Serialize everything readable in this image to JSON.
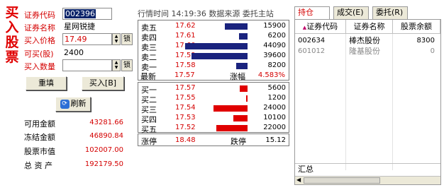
{
  "title": {
    "chars": [
      "买",
      "入",
      "股",
      "票"
    ]
  },
  "form": {
    "code_label": "证券代码",
    "code_value": "002396",
    "name_label": "证券名称",
    "name_value": "星网锐捷",
    "price_label": "买入价格",
    "price_value": "17.49",
    "avail_label": "可买(股)",
    "avail_value": "2400",
    "qty_label": "买入数量",
    "qty_value": "",
    "lock_label": "锁",
    "reset_button": "重填",
    "buy_button": "买入[B]",
    "refresh_button": "刷新"
  },
  "account": [
    {
      "label": "可用金额",
      "value": "43281.66"
    },
    {
      "label": "冻结金额",
      "value": "46890.84"
    },
    {
      "label": "股票市值",
      "value": "102007.00"
    },
    {
      "label": "总 资 产",
      "value": "192179.50"
    }
  ],
  "quote": {
    "header": "行情时间 14:19:36 数据来源 委托主站",
    "sell": [
      {
        "name": "卖五",
        "price": "17.62",
        "vol": "15900",
        "vol_num": 15900
      },
      {
        "name": "卖四",
        "price": "17.61",
        "vol": "6200",
        "vol_num": 6200
      },
      {
        "name": "卖三",
        "price": "17.60",
        "vol": "44090",
        "vol_num": 44090
      },
      {
        "name": "卖二",
        "price": "17.59",
        "vol": "39600",
        "vol_num": 39600
      },
      {
        "name": "卖一",
        "price": "17.58",
        "vol": "8200",
        "vol_num": 8200
      }
    ],
    "latest_label": "最新",
    "latest_value": "17.57",
    "change_label": "涨幅",
    "change_value": "4.583%",
    "buy": [
      {
        "name": "买一",
        "price": "17.57",
        "vol": "5600",
        "vol_num": 5600
      },
      {
        "name": "买二",
        "price": "17.55",
        "vol": "1200",
        "vol_num": 1200
      },
      {
        "name": "买三",
        "price": "17.54",
        "vol": "24000",
        "vol_num": 24000
      },
      {
        "name": "买四",
        "price": "17.53",
        "vol": "10100",
        "vol_num": 10100
      },
      {
        "name": "买五",
        "price": "17.52",
        "vol": "22000",
        "vol_num": 22000
      }
    ],
    "limit_up_label": "涨停",
    "limit_up_value": "18.48",
    "limit_down_label": "跌停",
    "limit_down_value": "15.12",
    "colors": {
      "sell_bar": "#1a237e",
      "buy_bar": "#e00000"
    }
  },
  "tabs": [
    {
      "label": "持仓(W)",
      "active": true
    },
    {
      "label": "成交(E)",
      "active": false
    },
    {
      "label": "委托(R)",
      "active": false
    }
  ],
  "holdings": {
    "columns": [
      "证券代码",
      "证券名称",
      "股票余额"
    ],
    "rows": [
      {
        "code": "002634",
        "name": "棒杰股份",
        "balance": "8300"
      },
      {
        "code": "601012",
        "name": "隆基股份",
        "balance": "0"
      }
    ],
    "total_label": "汇总"
  }
}
